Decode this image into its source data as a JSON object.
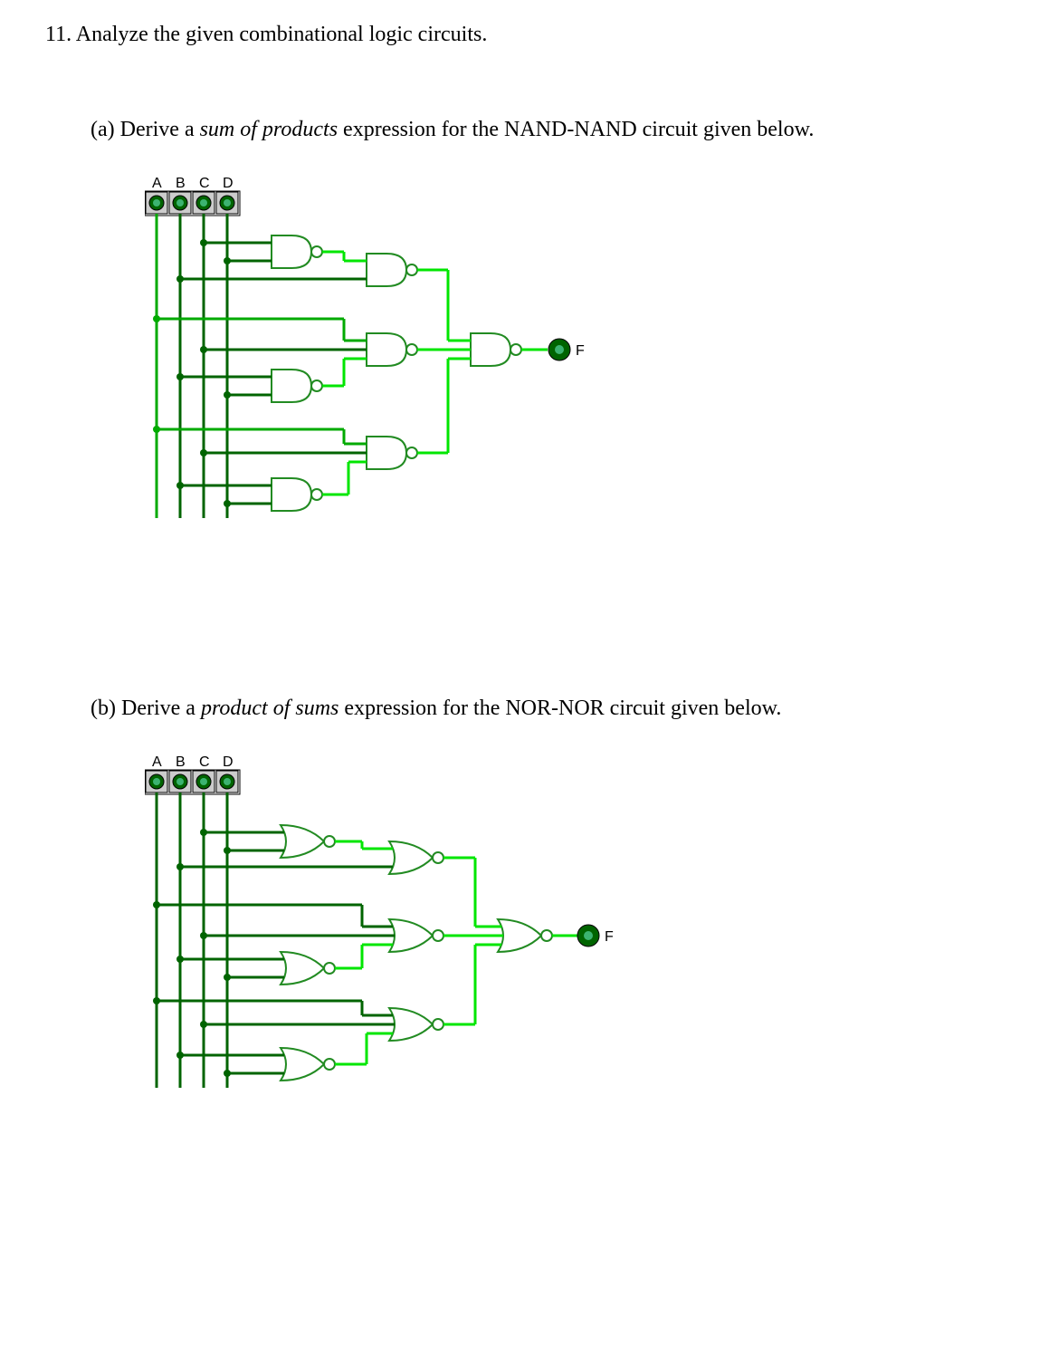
{
  "question": {
    "number": "11.",
    "text": " Analyze the given combinational logic circuits."
  },
  "partA": {
    "label": "(a)",
    "prefix": "  Derive a ",
    "italic": "sum of products",
    "suffix": " expression for the NAND-NAND circuit given below."
  },
  "partB": {
    "label": "(b)",
    "prefix": "  Derive a ",
    "italic": "product of sums",
    "suffix": " expression for the NOR-NOR circuit given below."
  },
  "inputs": {
    "A": "A",
    "B": "B",
    "C": "C",
    "D": "D"
  },
  "output": {
    "F": "F"
  }
}
